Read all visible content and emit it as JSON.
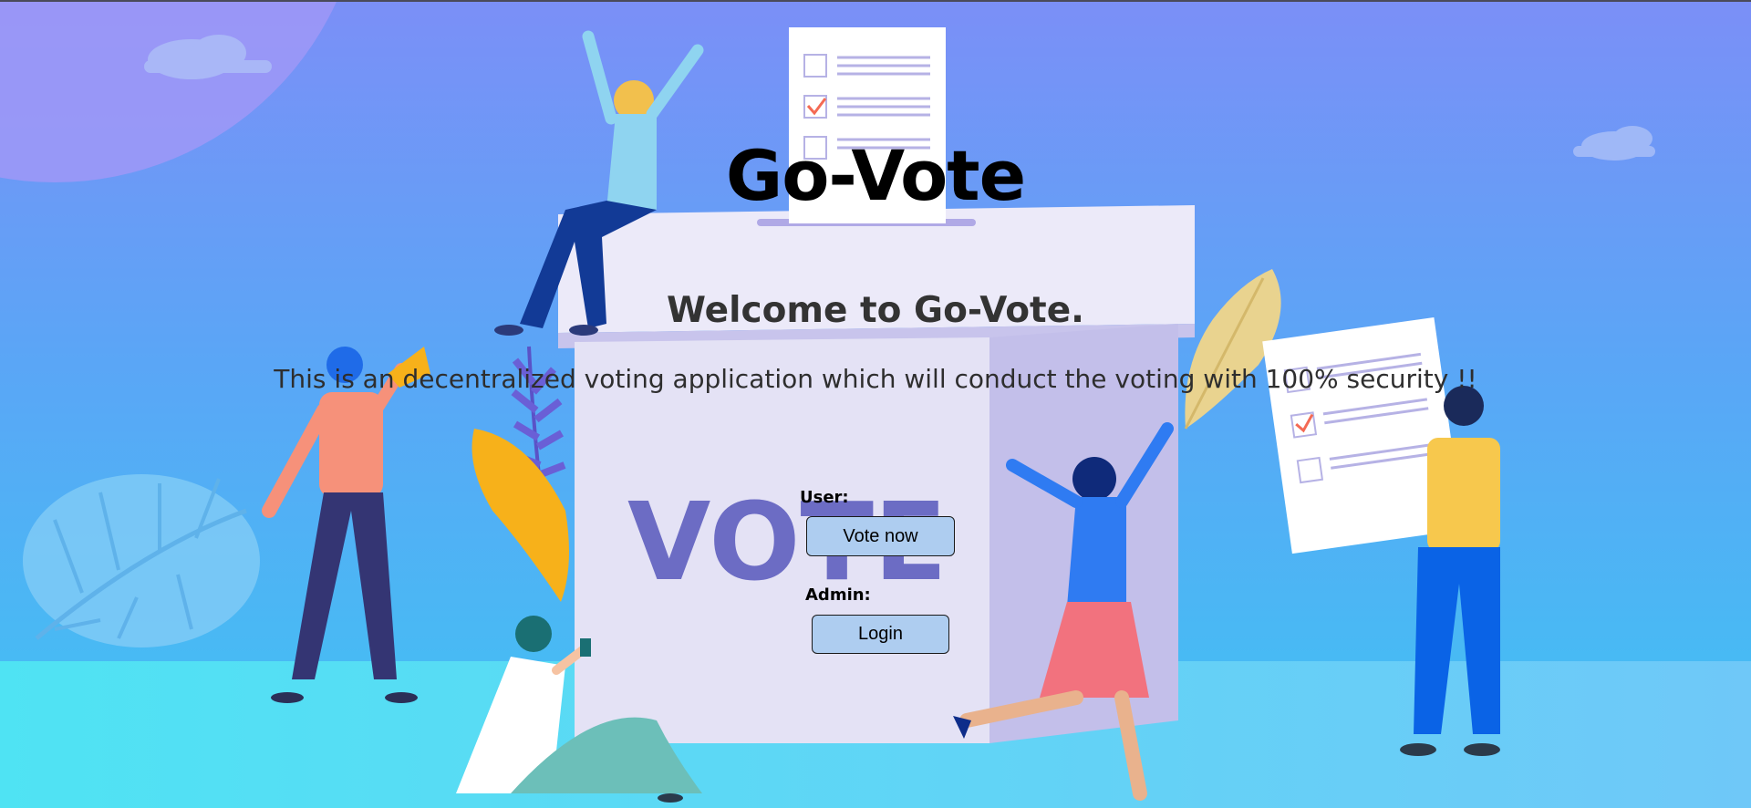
{
  "app": {
    "title": "Go-Vote",
    "welcome": "Welcome to Go-Vote.",
    "tagline": "This is an decentralized voting application which will conduct the voting with 100% security !!"
  },
  "user_section": {
    "label": "User:",
    "button_label": "Vote now"
  },
  "admin_section": {
    "label": "Admin:",
    "button_label": "Login"
  },
  "illustration": {
    "ballot_box_text": "VOTE"
  },
  "colors": {
    "sky_top": "#7b8ff7",
    "sky_bottom": "#3fc0f0",
    "ground": "#4fe0f2",
    "button_bg": "#aecdf0",
    "ballot_box": "#e4e2f5",
    "vote_text": "#6c6cc4"
  }
}
